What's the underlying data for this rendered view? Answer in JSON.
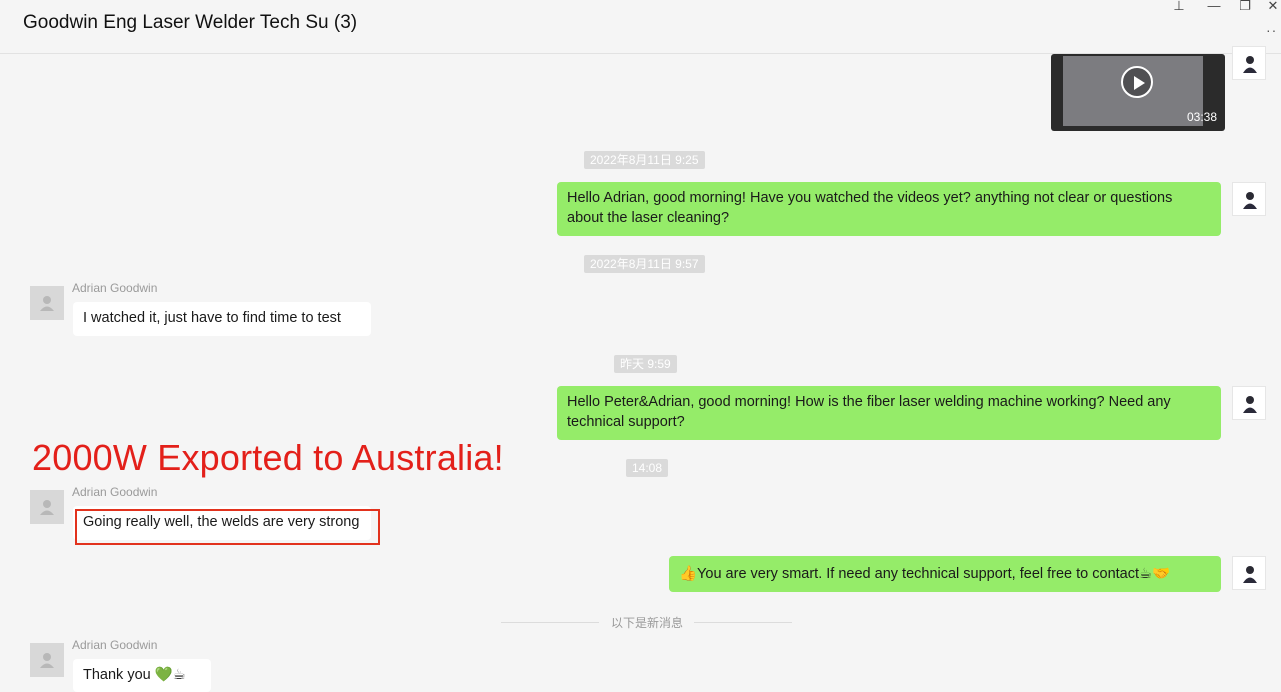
{
  "window": {
    "title": "Goodwin Eng Laser Welder Tech Su (3)",
    "controls": {
      "pin": "⊥",
      "minimize": "—",
      "restore": "❐",
      "close": "✕",
      "more": "··"
    }
  },
  "video": {
    "duration": "03:38"
  },
  "timestamps": {
    "t1": "2022年8月11日 9:25",
    "t2": "2022年8月11日 9:57",
    "t3": "昨天 9:59",
    "t4": "14:08"
  },
  "messages": {
    "m1": "Hello Adrian, good morning! Have you watched the videos yet? anything not clear or questions about the laser cleaning?",
    "m2_sender": "Adrian Goodwin",
    "m2": "I watched it, just have to find time to test",
    "m3": "Hello Peter&Adrian, good morning! How is the fiber laser welding machine working? Need any technical support?",
    "m4_sender": "Adrian Goodwin",
    "m4": "Going really well, the welds are very strong",
    "m5": "👍You are very smart. If need any technical support, feel free to contact☕🤝",
    "m6_sender": "Adrian Goodwin",
    "m6": "Thank you 💚☕"
  },
  "overlay": {
    "headline": "2000W Exported to Australia!"
  },
  "divider": {
    "new_messages": "以下是新消息"
  },
  "colors": {
    "my_bubble": "#95ec69",
    "other_bubble": "#ffffff",
    "highlight": "#e2321d",
    "headline": "#e3201a"
  }
}
